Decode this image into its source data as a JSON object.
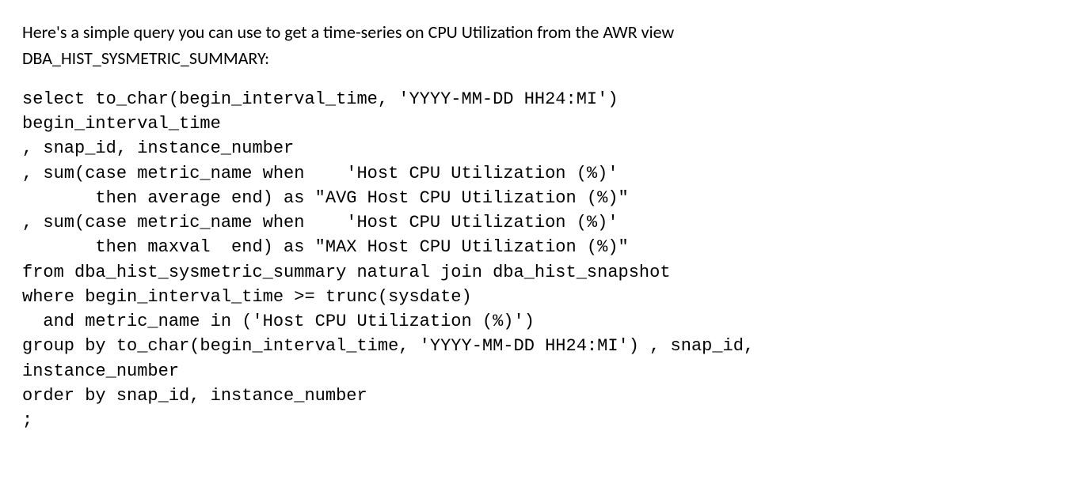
{
  "intro": {
    "line1": "Here's a simple query you can use to get a time-series on CPU Utilization from the AWR view",
    "line2": "DBA_HIST_SYSMETRIC_SUMMARY:"
  },
  "code": {
    "l1": "select to_char(begin_interval_time, 'YYYY-MM-DD HH24:MI')",
    "l2": "begin_interval_time",
    "l3": ", snap_id, instance_number",
    "l4": ", sum(case metric_name when    'Host CPU Utilization (%)'",
    "l5": "       then average end) as \"AVG Host CPU Utilization (%)\"",
    "l6": ", sum(case metric_name when    'Host CPU Utilization (%)'",
    "l7": "       then maxval  end) as \"MAX Host CPU Utilization (%)\"",
    "l8": "from dba_hist_sysmetric_summary natural join dba_hist_snapshot",
    "l9": "where begin_interval_time >= trunc(sysdate)",
    "l10": "  and metric_name in ('Host CPU Utilization (%)')",
    "l11": "group by to_char(begin_interval_time, 'YYYY-MM-DD HH24:MI') , snap_id,",
    "l12": "instance_number",
    "l13": "order by snap_id, instance_number",
    "l14": ";"
  }
}
